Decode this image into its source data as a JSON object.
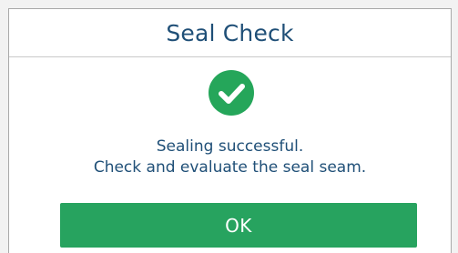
{
  "dialog": {
    "title": "Seal Check",
    "message_lines": [
      "Sealing successful.",
      "Check and evaluate the seal seam."
    ],
    "ok_label": "OK",
    "status_icon": "check-circle-icon"
  },
  "colors": {
    "title_text": "#1f4f77",
    "success_green": "#25a65a",
    "button_green": "#27a35f",
    "button_text": "#ffffff",
    "divider": "#c9c9c9"
  }
}
